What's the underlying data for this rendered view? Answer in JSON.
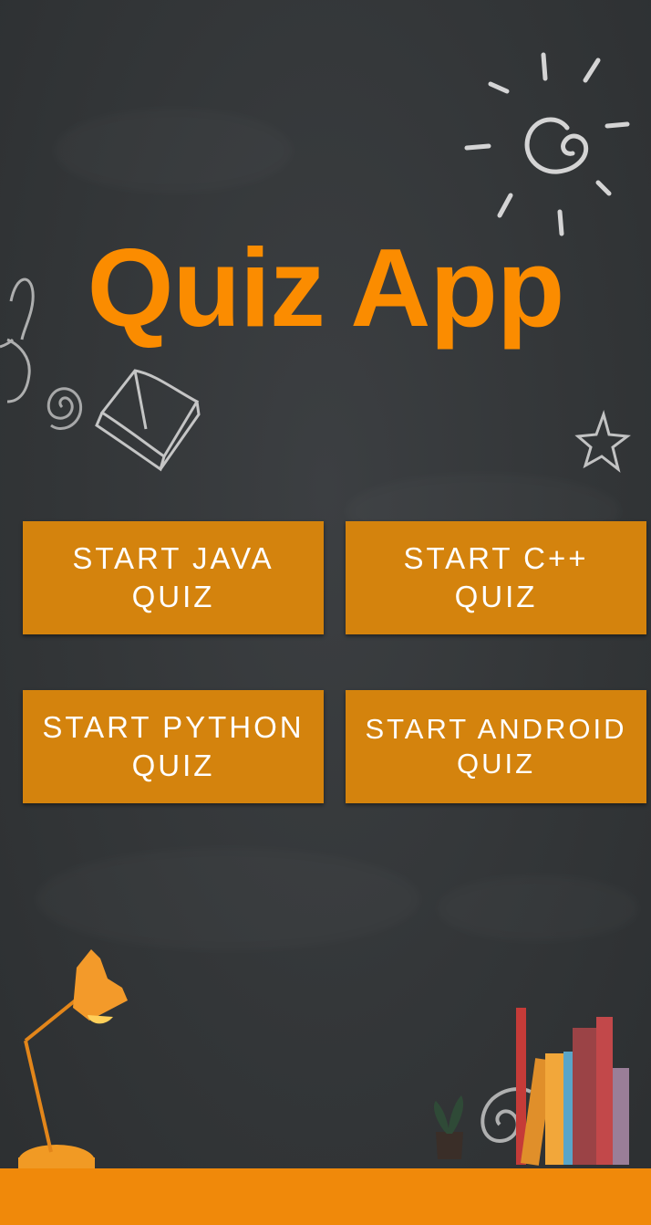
{
  "app": {
    "title": "Quiz App"
  },
  "buttons": {
    "java": "START JAVA QUIZ",
    "cpp": "START C++ QUIZ",
    "python": "START PYTHON QUIZ",
    "android": "START ANDROID QUIZ"
  },
  "colors": {
    "background": "#333638",
    "title": "#fb8c00",
    "button": "#d4830d",
    "button_text": "#ffffff",
    "floor": "#f0890a"
  },
  "icons": [
    "sun-doodle-icon",
    "book-doodle-icon",
    "star-doodle-icon",
    "bunny-doodle-icon",
    "swirl-doodle-icon",
    "desk-lamp-icon",
    "books-icon",
    "plant-icon"
  ]
}
